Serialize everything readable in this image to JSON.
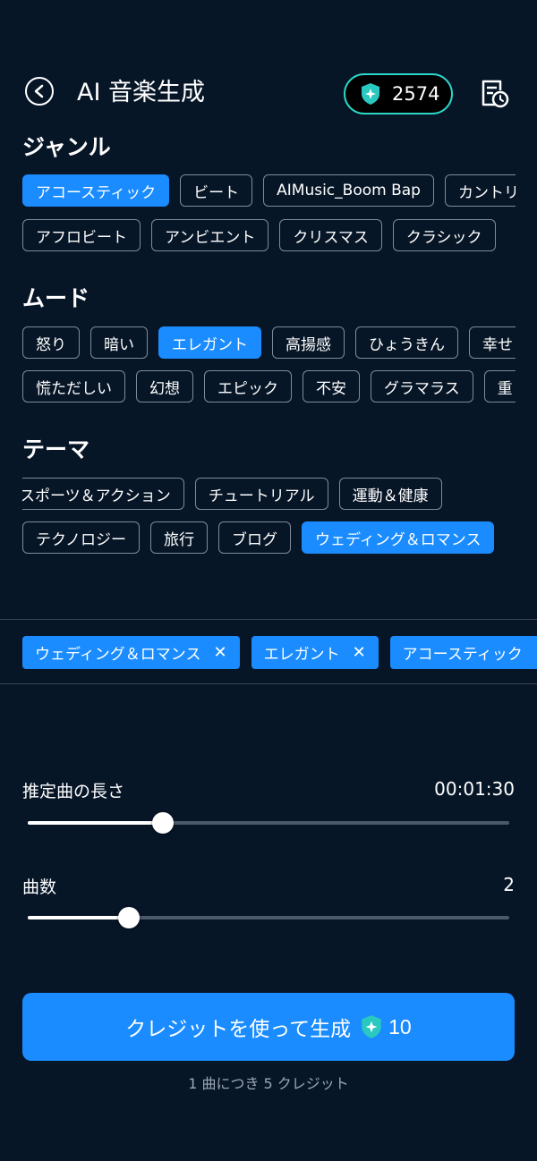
{
  "header": {
    "title": "AI 音楽生成",
    "credits": "2574"
  },
  "genre": {
    "title": "ジャンル",
    "row1": [
      "アコースティック",
      "ビート",
      "AIMusic_Boom Bap",
      "カントリー"
    ],
    "row2": [
      "アフロビート",
      "アンビエント",
      "クリスマス",
      "クラシック"
    ]
  },
  "mood": {
    "title": "ムード",
    "row1": [
      "怒り",
      "暗い",
      "エレガント",
      "高揚感",
      "ひょうきん",
      "幸せ"
    ],
    "row2": [
      "慌ただしい",
      "幻想",
      "エピック",
      "不安",
      "グラマラス",
      "重"
    ]
  },
  "theme": {
    "title": "テーマ",
    "row1": [
      "スポーツ＆アクション",
      "チュートリアル",
      "運動＆健康"
    ],
    "row2": [
      "テクノロジー",
      "旅行",
      "ブログ",
      "ウェディング＆ロマンス"
    ]
  },
  "selected": [
    "ウェディング＆ロマンス",
    "エレガント",
    "アコースティック"
  ],
  "duration": {
    "label": "推定曲の長さ",
    "value": "00:01:30",
    "level_percent": 28
  },
  "count": {
    "label": "曲数",
    "value": "2",
    "level_percent": 21
  },
  "generate": {
    "label": "クレジットを使って生成",
    "cost": "10",
    "note": "1 曲につき 5 クレジット"
  },
  "colors": {
    "accent": "#1a8cff",
    "background": "#071627",
    "pill_border": "#2bd6c8"
  }
}
